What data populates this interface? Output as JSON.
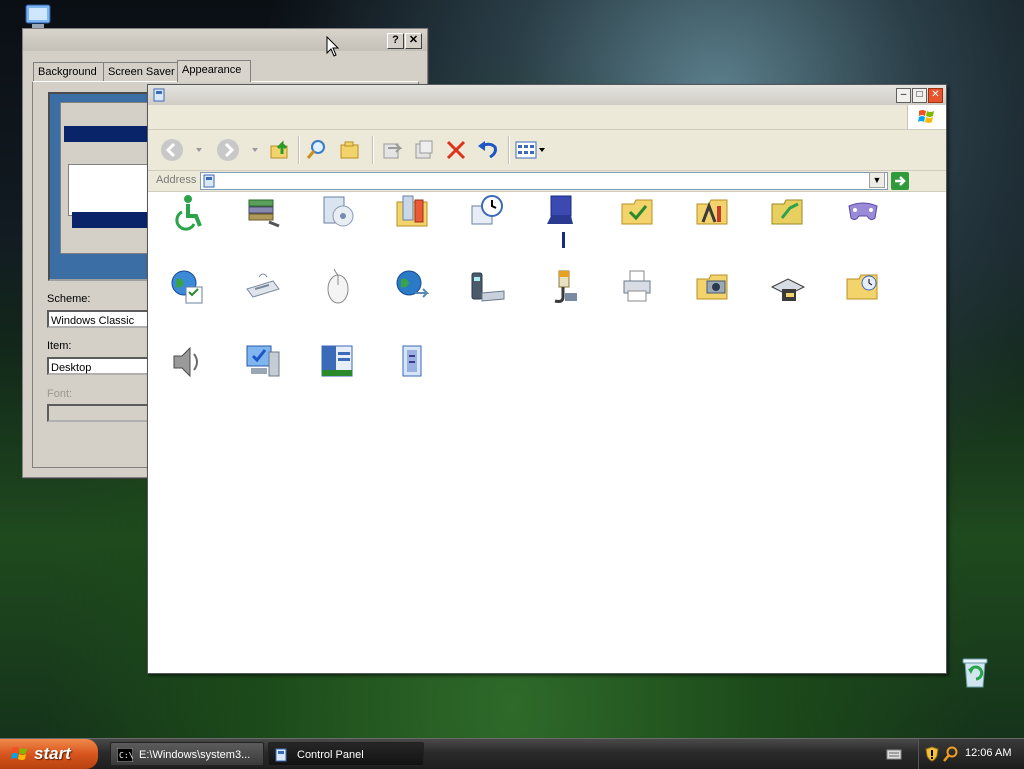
{
  "display_dialog": {
    "title_buttons": {
      "help": "?",
      "close": "✕"
    },
    "tabs": [
      {
        "label": "Background",
        "active": false
      },
      {
        "label": "Screen Saver",
        "active": false
      },
      {
        "label": "Appearance",
        "active": true
      }
    ],
    "scheme_label": "Scheme:",
    "scheme_value": "Windows Classic",
    "item_label": "Item:",
    "item_value": "Desktop",
    "font_label": "Font:"
  },
  "control_panel": {
    "window_buttons": {
      "minimize": "–",
      "maximize": "□",
      "close": "✕"
    },
    "address_label": "Address",
    "address_value": "",
    "address_dropdown": "▼",
    "colors": {
      "accent_blue": "#1d55c4",
      "window_bg": "#ffffff",
      "chrome": "#ece9d8"
    },
    "toolbar": {
      "back": "back-icon",
      "forward": "forward-icon",
      "up": "up-folder-icon",
      "search": "search-icon",
      "folders": "folders-icon",
      "move_to": "move-to-icon",
      "copy_to": "copy-to-icon",
      "delete": "delete-icon",
      "undo": "undo-icon",
      "views": "views-icon"
    },
    "icons": [
      "accessibility-icon",
      "add-hardware-icon",
      "add-remove-programs-icon",
      "administrative-tools-icon",
      "date-time-icon",
      "display-icon",
      "folder-options-icon",
      "fonts-icon",
      "folder-share-icon",
      "game-controllers-icon",
      "internet-options-icon",
      "keyboard-icon",
      "mouse-icon",
      "network-connections-icon",
      "phone-modem-icon",
      "power-options-icon",
      "printers-icon",
      "scanners-cameras-icon",
      "scheduled-tasks-icon",
      "folder-options-2-icon",
      "sounds-icon",
      "system-icon",
      "taskbar-start-menu-icon",
      "user-accounts-icon"
    ]
  },
  "taskbar": {
    "start_label": "start",
    "tasks": [
      {
        "label": "E:\\Windows\\system3...",
        "active": false
      },
      {
        "label": "Control Panel",
        "active": true
      }
    ],
    "clock": "12:06 AM"
  }
}
